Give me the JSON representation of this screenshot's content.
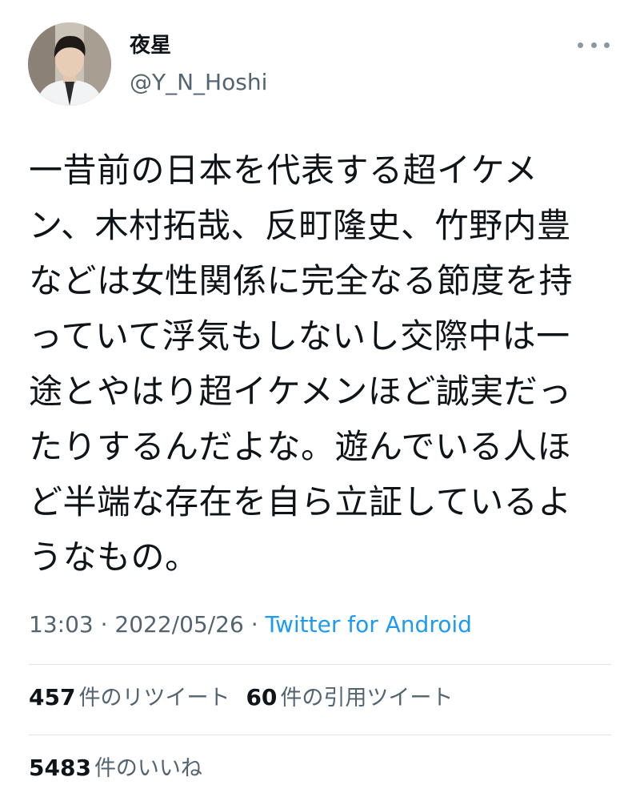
{
  "author": {
    "display_name": "夜星",
    "handle": "@Y_N_Hoshi"
  },
  "tweet": {
    "text": "一昔前の日本を代表する超イケメ\nン、木村拓哉、反町隆史、竹野内豊\nなどは女性関係に完全なる節度を持\nっていて浮気もしないし交際中は一\n途とやはり超イケメンほど誠実だっ\nたりするんだよな。遊んでいる人ほ\nど半端な存在を自ら立証しているよ\nうなもの。",
    "time": "13:03",
    "separator": " · ",
    "date": "2022/05/26",
    "source": "Twitter for Android"
  },
  "stats": {
    "retweets_count": "457",
    "retweets_label": "件のリツイート",
    "quotes_count": "60",
    "quotes_label": "件の引用ツイート",
    "likes_count": "5483",
    "likes_label": "件のいいね"
  },
  "icons": {
    "more": "more-horizontal-icon"
  },
  "colors": {
    "link": "#1d9bf0",
    "secondary_text": "#536471"
  }
}
